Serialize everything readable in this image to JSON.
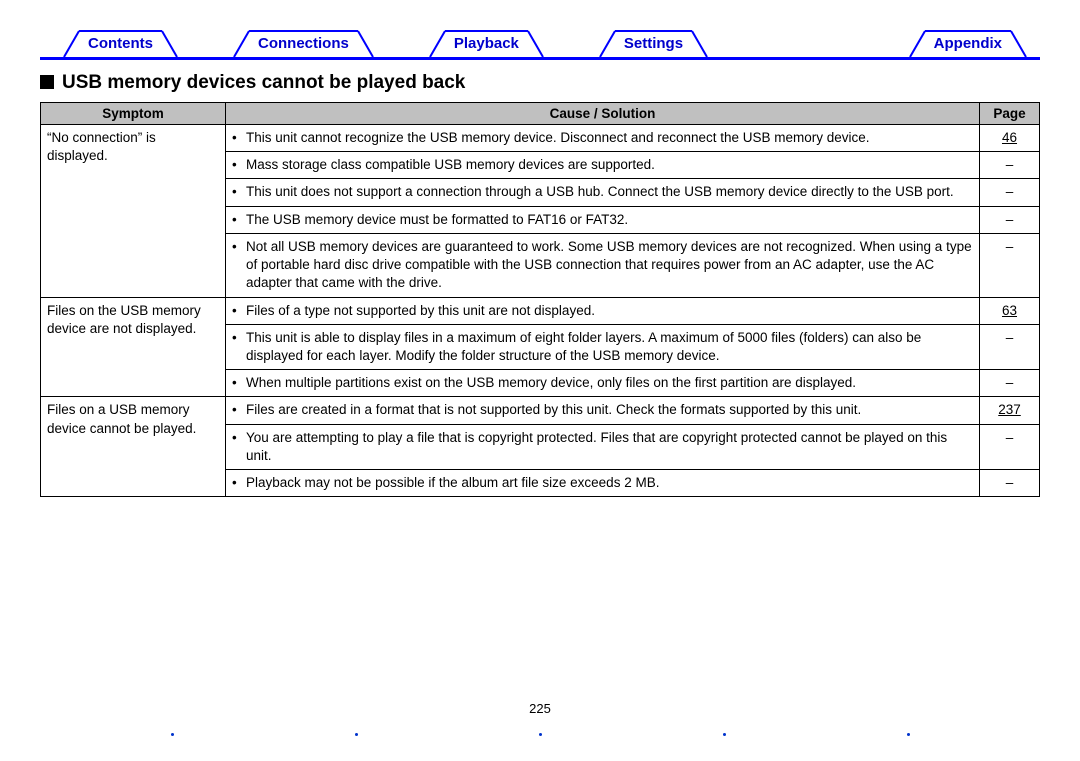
{
  "tabs": {
    "contents": "Contents",
    "connections": "Connections",
    "playback": "Playback",
    "settings": "Settings",
    "appendix": "Appendix"
  },
  "heading": "USB memory devices cannot be played back",
  "columns": {
    "symptom": "Symptom",
    "cause": "Cause / Solution",
    "page": "Page"
  },
  "groups": [
    {
      "symptom": "“No connection” is displayed.",
      "rows": [
        {
          "cause": "This unit cannot recognize the USB memory device. Disconnect and reconnect the USB memory device.",
          "page": "46",
          "link": true
        },
        {
          "cause": "Mass storage class compatible USB memory devices are supported.",
          "page": "–",
          "link": false
        },
        {
          "cause": "This unit does not support a connection through a USB hub. Connect the USB memory device directly to the USB port.",
          "page": "–",
          "link": false
        },
        {
          "cause": "The USB memory device must be formatted to FAT16 or FAT32.",
          "page": "–",
          "link": false
        },
        {
          "cause": "Not all USB memory devices are guaranteed to work. Some USB memory devices are not recognized. When using a type of portable hard disc drive compatible with the USB connection that requires power from an AC adapter, use the AC adapter that came with the drive.",
          "page": "–",
          "link": false
        }
      ]
    },
    {
      "symptom": "Files on the USB memory device are not displayed.",
      "rows": [
        {
          "cause": "Files of a type not supported by this unit are not displayed.",
          "page": "63",
          "link": true
        },
        {
          "cause": "This unit is able to display files in a maximum of eight folder layers. A maximum of 5000 files (folders) can also be displayed for each layer. Modify the folder structure of the USB memory device.",
          "page": "–",
          "link": false
        },
        {
          "cause": "When multiple partitions exist on the USB memory device, only files on the first partition are displayed.",
          "page": "–",
          "link": false
        }
      ]
    },
    {
      "symptom": "Files on a USB memory device cannot be played.",
      "rows": [
        {
          "cause": "Files are created in a format that is not supported by this unit. Check the formats supported by this unit.",
          "page": "237",
          "link": true
        },
        {
          "cause": "You are attempting to play a file that is copyright protected. Files that are copyright protected cannot be played on this unit.",
          "page": "–",
          "link": false
        },
        {
          "cause": "Playback may not be possible if the album art file size exceeds 2 MB.",
          "page": "–",
          "link": false
        }
      ]
    }
  ],
  "page_number": "225"
}
